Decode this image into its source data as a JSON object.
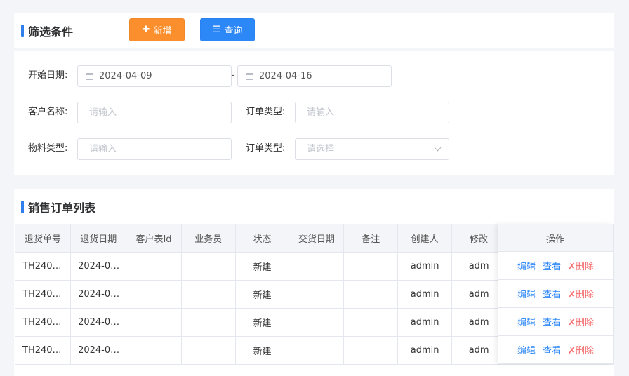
{
  "header": {
    "title": "筛选条件",
    "add_label": "新增",
    "query_label": "查询"
  },
  "filters": {
    "start_date_label": "开始日期:",
    "start_date_from": "2024-04-09",
    "start_date_to": "2024-04-16",
    "date_separator": "-",
    "customer_label": "客户名称:",
    "customer_placeholder": "请输入",
    "order_type_label": "订单类型:",
    "order_type_placeholder": "请输入",
    "material_type_label": "物料类型:",
    "material_type_placeholder": "请输入",
    "order_type2_label": "订单类型:",
    "order_type2_placeholder": "请选择"
  },
  "list": {
    "title": "销售订单列表",
    "columns": [
      "退货单号",
      "退货日期",
      "客户表Id",
      "业务员",
      "状态",
      "交货日期",
      "备注",
      "创建人",
      "修改"
    ],
    "op_column": "操作",
    "rows": [
      [
        "TH240…",
        "2024-0…",
        "",
        "",
        "新建",
        "",
        "",
        "admin",
        "adm"
      ],
      [
        "TH240…",
        "2024-0…",
        "",
        "",
        "新建",
        "",
        "",
        "admin",
        "adm"
      ],
      [
        "TH240…",
        "2024-0…",
        "",
        "",
        "新建",
        "",
        "",
        "admin",
        "adm"
      ],
      [
        "TH240…",
        "2024-0…",
        "",
        "",
        "新建",
        "",
        "",
        "admin",
        "adm"
      ]
    ],
    "actions": {
      "edit": "编辑",
      "view": "查看",
      "delete": "删除"
    }
  },
  "colors": {
    "accent": "#2c87f7",
    "add": "#fb8f2d",
    "danger": "#f56c6c"
  }
}
